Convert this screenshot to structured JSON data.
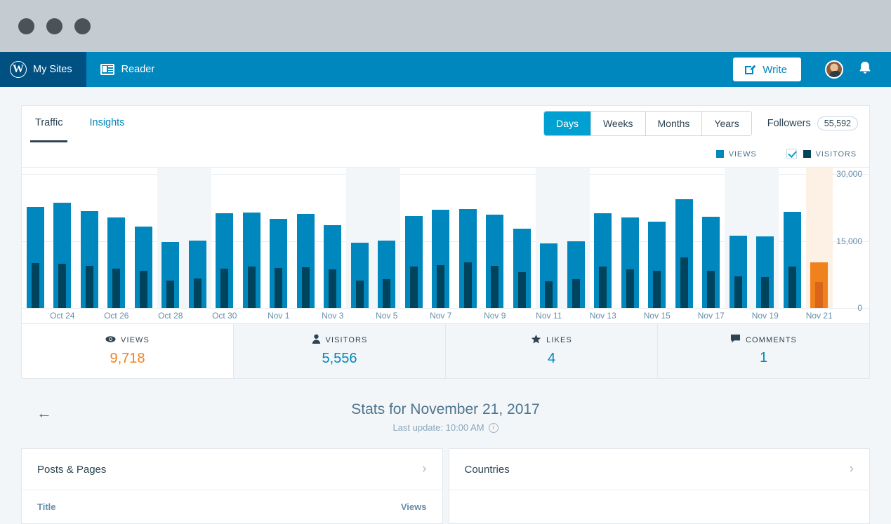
{
  "window": {
    "dots": [
      "close",
      "minimize",
      "maximize"
    ]
  },
  "masterbar": {
    "my_sites": "My Sites",
    "reader": "Reader",
    "write": "Write",
    "icons": {
      "wp": "W",
      "bell": "bell-icon",
      "avatar": "user-avatar"
    }
  },
  "tabs": [
    {
      "label": "Traffic",
      "active": true
    },
    {
      "label": "Insights",
      "active": false
    }
  ],
  "period": {
    "options": [
      {
        "label": "Days",
        "active": true
      },
      {
        "label": "Weeks",
        "active": false
      },
      {
        "label": "Months",
        "active": false
      },
      {
        "label": "Years",
        "active": false
      }
    ]
  },
  "followers": {
    "label": "Followers",
    "count": "55,592"
  },
  "legend": {
    "views": "VIEWS",
    "visitors": "VISITORS",
    "views_color": "#0087be",
    "visitors_color": "#00435c",
    "visitors_checked": true
  },
  "modules": [
    {
      "icon": "eye-icon",
      "label": "VIEWS",
      "value": "9,718",
      "active": true
    },
    {
      "icon": "person-icon",
      "label": "VISITORS",
      "value": "5,556",
      "active": false
    },
    {
      "icon": "star-icon",
      "label": "LIKES",
      "value": "4",
      "active": false
    },
    {
      "icon": "comment-icon",
      "label": "COMMENTS",
      "value": "1",
      "active": false
    }
  ],
  "stats_header": {
    "title": "Stats for November 21, 2017",
    "last_update": "Last update: 10:00 AM",
    "back": "back-arrow"
  },
  "bottom_cards": [
    {
      "title": "Posts & Pages",
      "columns": [
        "Title",
        "Views"
      ],
      "has_columns": true
    },
    {
      "title": "Countries",
      "columns": [],
      "has_columns": false
    }
  ],
  "colors": {
    "brand_blue": "#0087be",
    "dark_blue": "#005082",
    "accent_orange": "#f0821e",
    "visitors_navy": "#00435c",
    "page_bg": "#f3f6f8"
  },
  "chart_data": {
    "type": "bar",
    "title": "",
    "xlabel": "",
    "ylabel": "",
    "ylim": [
      0,
      30000
    ],
    "yticks": [
      0,
      15000,
      30000
    ],
    "ytick_labels": [
      "0",
      "15,000",
      "30,000"
    ],
    "grid": true,
    "legend_position": "top-right",
    "categories": [
      "Oct 23",
      "Oct 24",
      "Oct 25",
      "Oct 26",
      "Oct 27",
      "Oct 28",
      "Oct 29",
      "Oct 30",
      "Oct 31",
      "Nov 1",
      "Nov 2",
      "Nov 3",
      "Nov 4",
      "Nov 5",
      "Nov 6",
      "Nov 7",
      "Nov 8",
      "Nov 9",
      "Nov 10",
      "Nov 11",
      "Nov 12",
      "Nov 13",
      "Nov 14",
      "Nov 15",
      "Nov 16",
      "Nov 17",
      "Nov 18",
      "Nov 19",
      "Nov 20",
      "Nov 21"
    ],
    "tick_labels_shown": [
      "",
      "Oct 24",
      "",
      "Oct 26",
      "",
      "Oct 28",
      "",
      "Oct 30",
      "",
      "Nov 1",
      "",
      "Nov 3",
      "",
      "Nov 5",
      "",
      "Nov 7",
      "",
      "Nov 9",
      "",
      "Nov 11",
      "",
      "Nov 13",
      "",
      "Nov 15",
      "",
      "Nov 17",
      "",
      "Nov 19",
      "",
      "Nov 21"
    ],
    "weekend_columns": [
      "Oct 28",
      "Oct 29",
      "Nov 4",
      "Nov 5",
      "Nov 11",
      "Nov 12",
      "Nov 18",
      "Nov 19"
    ],
    "selected_column": "Nov 21",
    "series": [
      {
        "name": "Views",
        "color": "#0087be",
        "values": [
          21600,
          22500,
          20700,
          19400,
          17400,
          14100,
          14400,
          20200,
          20400,
          19100,
          20100,
          17700,
          13900,
          14400,
          19600,
          21000,
          21200,
          19900,
          16900,
          13800,
          14300,
          20300,
          19400,
          18500,
          23300,
          19500,
          15500,
          15300,
          20500,
          9718
        ]
      },
      {
        "name": "Visitors",
        "color": "#00435c",
        "values": [
          9600,
          9400,
          9000,
          8400,
          7900,
          5800,
          6300,
          8400,
          8800,
          8500,
          8700,
          8200,
          5900,
          6200,
          8800,
          9100,
          9800,
          9000,
          7600,
          5700,
          6200,
          8800,
          8300,
          8000,
          10800,
          8000,
          6800,
          6600,
          8900,
          5556
        ]
      }
    ]
  }
}
